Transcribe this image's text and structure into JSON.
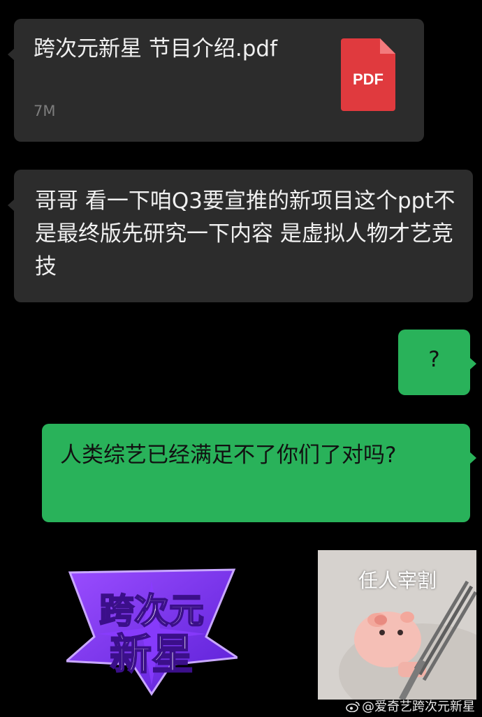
{
  "messages": {
    "file": {
      "title": "跨次元新星 节目介绍.pdf",
      "size": "7M",
      "icon_label": "PDF"
    },
    "received_text": "哥哥 看一下咱Q3要宣推的新项目这个ppt不是最终版先研究一下内容 是虚拟人物才艺竞技",
    "sent_question": "?",
    "sent_text": "人类综艺已经满足不了你们了对吗?"
  },
  "logo": {
    "line1": "跨次元",
    "line2": "新星"
  },
  "sticker": {
    "caption": "任人宰割"
  },
  "watermark": {
    "text": "@爱奇艺跨次元新星",
    "icon": "weibo-icon"
  },
  "colors": {
    "background": "#000000",
    "dark_bubble": "#2c2c2c",
    "green_bubble": "#29b25a",
    "pdf_red": "#e03a3e",
    "logo_purple": "#7a2df0"
  }
}
